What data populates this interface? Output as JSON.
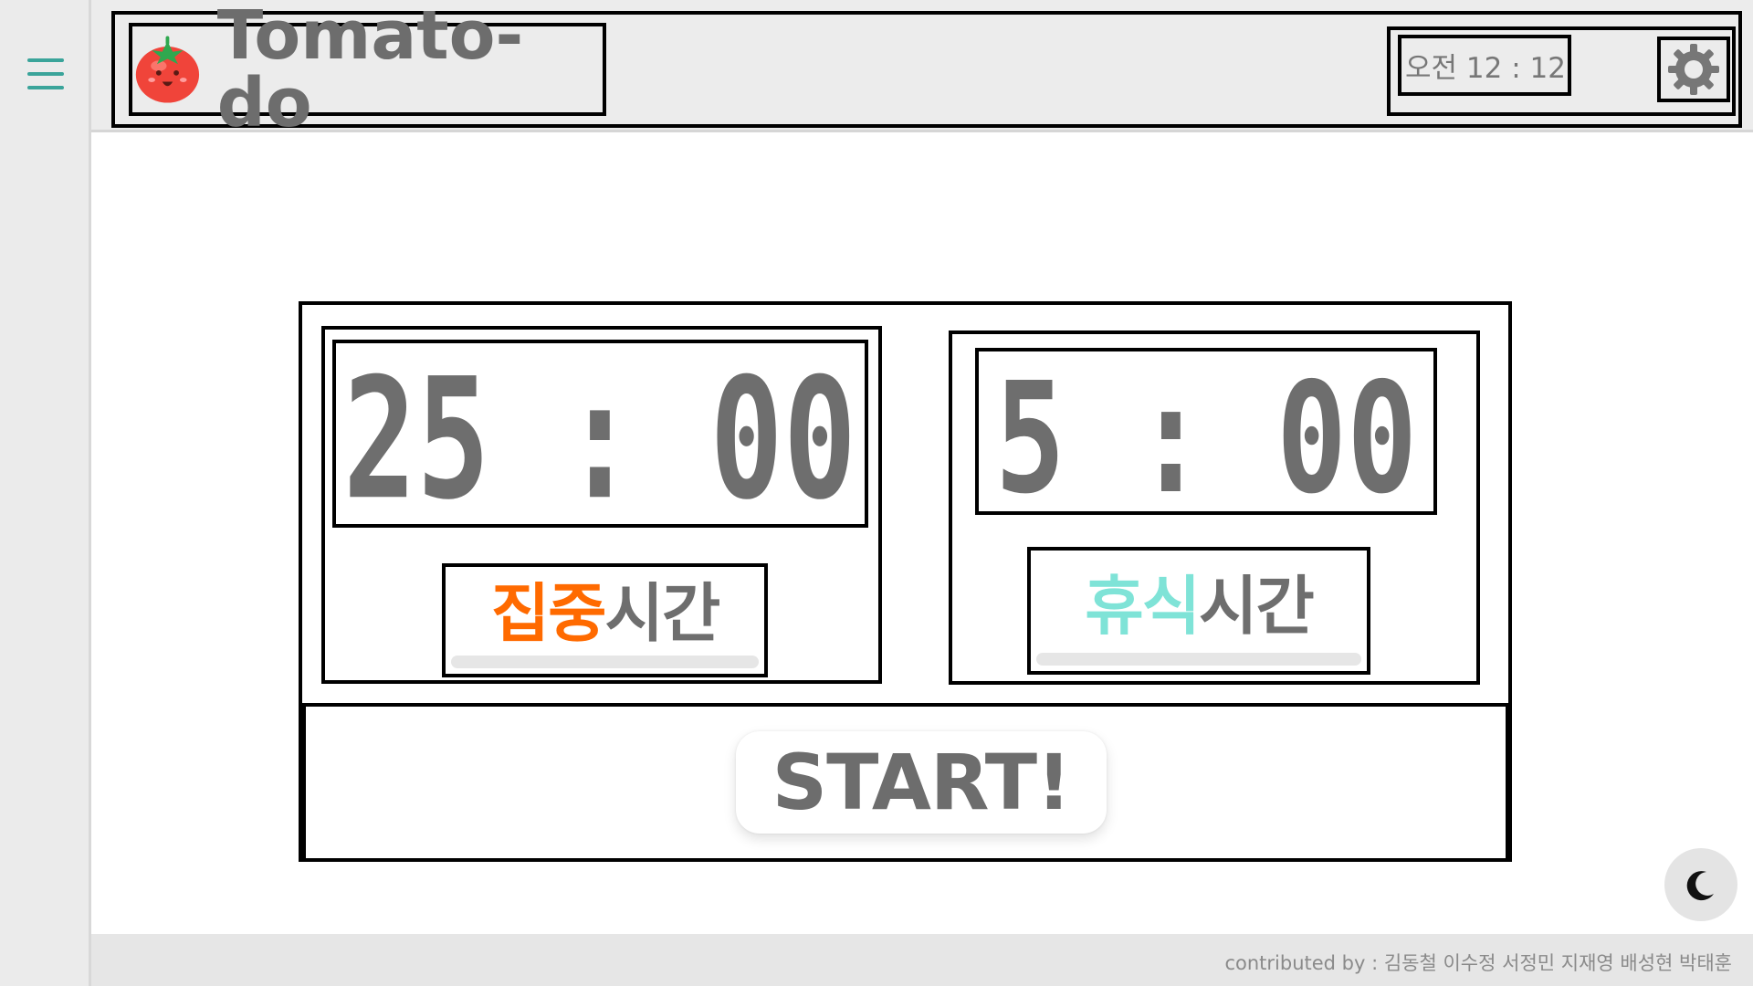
{
  "sidebar": {
    "menu_icon": "hamburger-menu-icon"
  },
  "header": {
    "logo_icon": "tomato-icon",
    "title": "Tomato-do",
    "clock": "오전 12 : 12",
    "settings_icon": "gear-icon"
  },
  "timers": {
    "focus": {
      "display": "25 : 00",
      "label_accent": "집중",
      "label_rest": "시간",
      "accent_color": "#ff6a00"
    },
    "break": {
      "display": "5 : 00",
      "label_accent": "휴식",
      "label_rest": "시간",
      "accent_color": "#7fe3d7"
    }
  },
  "start_button": {
    "label": "START!"
  },
  "theme_toggle": {
    "icon": "moon-icon"
  },
  "footer": {
    "credits": "contributed by : 김동철 이수정 서정민 지재영 배성현 박태훈"
  },
  "colors": {
    "accent_teal": "#3aa49a",
    "text_gray": "#6d6d6d",
    "header_bg": "#ececec"
  }
}
